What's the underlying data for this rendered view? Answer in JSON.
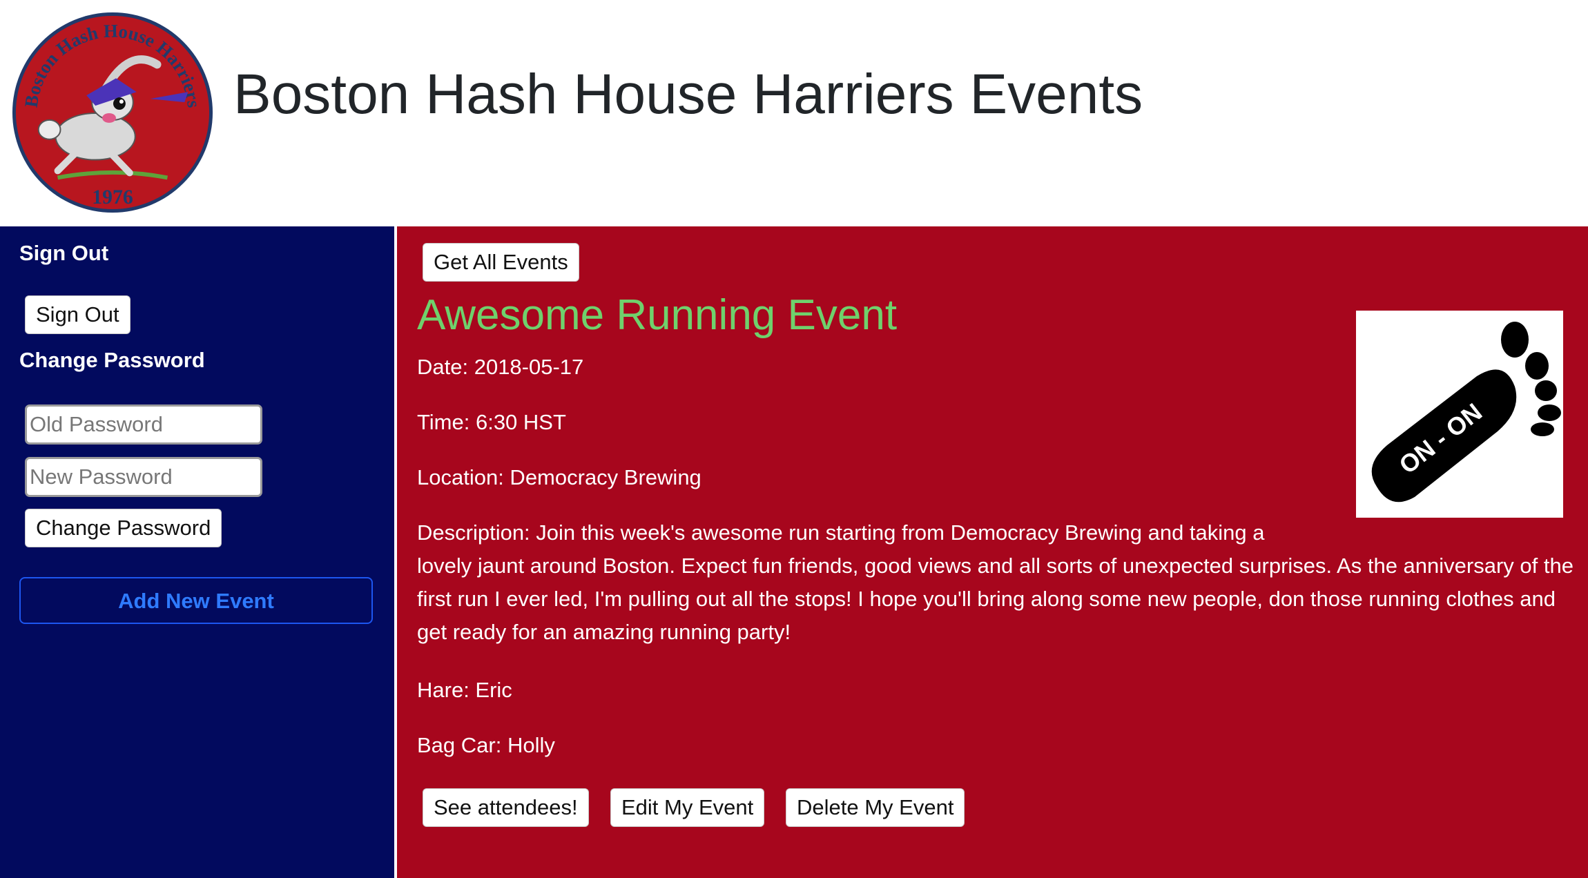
{
  "header": {
    "title": "Boston Hash House Harriers Events",
    "logo": {
      "top_text": "Boston Hash House Harriers",
      "year": "1976",
      "icon": "hare-mascot-icon"
    }
  },
  "sidebar": {
    "sign_out_heading": "Sign Out",
    "sign_out_button": "Sign Out",
    "change_password_heading": "Change Password",
    "old_password_placeholder": "Old Password",
    "new_password_placeholder": "New Password",
    "change_password_button": "Change Password",
    "add_event_button": "Add New Event"
  },
  "main": {
    "get_all_events_button": "Get All Events",
    "event": {
      "title": "Awesome Running Event",
      "date": "Date: 2018-05-17",
      "time": "Time: 6:30 HST",
      "location": "Location: Democracy Brewing",
      "description": "Description: Join this week's awesome run starting from Democracy Brewing and taking a lovely jaunt around Boston. Expect fun friends, good views and all sorts of unexpected surprises. As the anniversary of the first run I ever led, I'm pulling out all the stops! I hope you'll bring along some new people, don those running clothes and get ready for an amazing running party!",
      "hare": "Hare: Eric",
      "bag_car": "Bag Car: Holly",
      "image": {
        "icon": "footprint-icon",
        "text": "ON - ON"
      }
    },
    "actions": {
      "see_attendees": "See attendees!",
      "edit": "Edit My Event",
      "delete": "Delete My Event"
    }
  },
  "colors": {
    "sidebar_bg": "#020a5e",
    "main_bg": "#a7061d",
    "event_title": "#6fd16c",
    "add_event_text": "#2f7bff",
    "add_event_border": "#1d56f0"
  }
}
